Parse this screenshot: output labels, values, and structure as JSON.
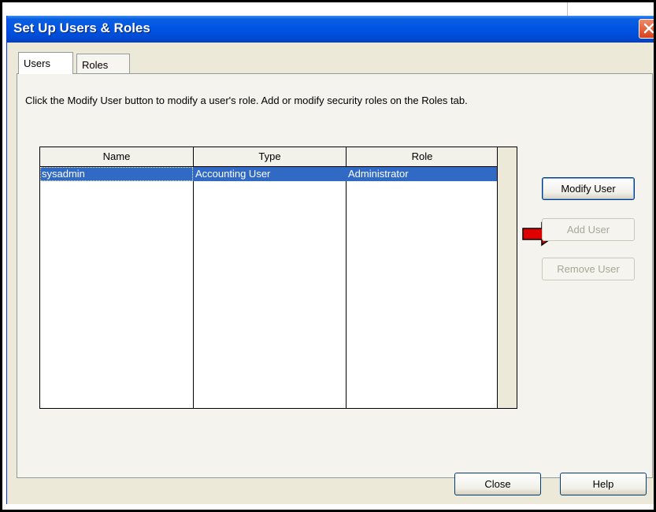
{
  "window": {
    "title": "Set Up Users & Roles"
  },
  "tabs": [
    {
      "label": "Users",
      "active": true
    },
    {
      "label": "Roles",
      "active": false
    }
  ],
  "users_tab": {
    "instructions": "Click the Modify User button to modify a user's role. Add or modify security roles on the Roles tab.",
    "table": {
      "columns": [
        "Name",
        "Type",
        "Role"
      ],
      "rows": [
        {
          "name": "sysadmin",
          "type": "Accounting User",
          "role": "Administrator",
          "selected": true
        }
      ]
    },
    "buttons": {
      "modify": "Modify User",
      "add": "Add User",
      "remove": "Remove User"
    }
  },
  "footer": {
    "close": "Close",
    "help": "Help"
  },
  "colors": {
    "titlebar": "#0054e3",
    "selection": "#316ac5",
    "annotation_arrow": "#e00000"
  },
  "icons": [
    "close-icon",
    "red-arrow-icon"
  ]
}
